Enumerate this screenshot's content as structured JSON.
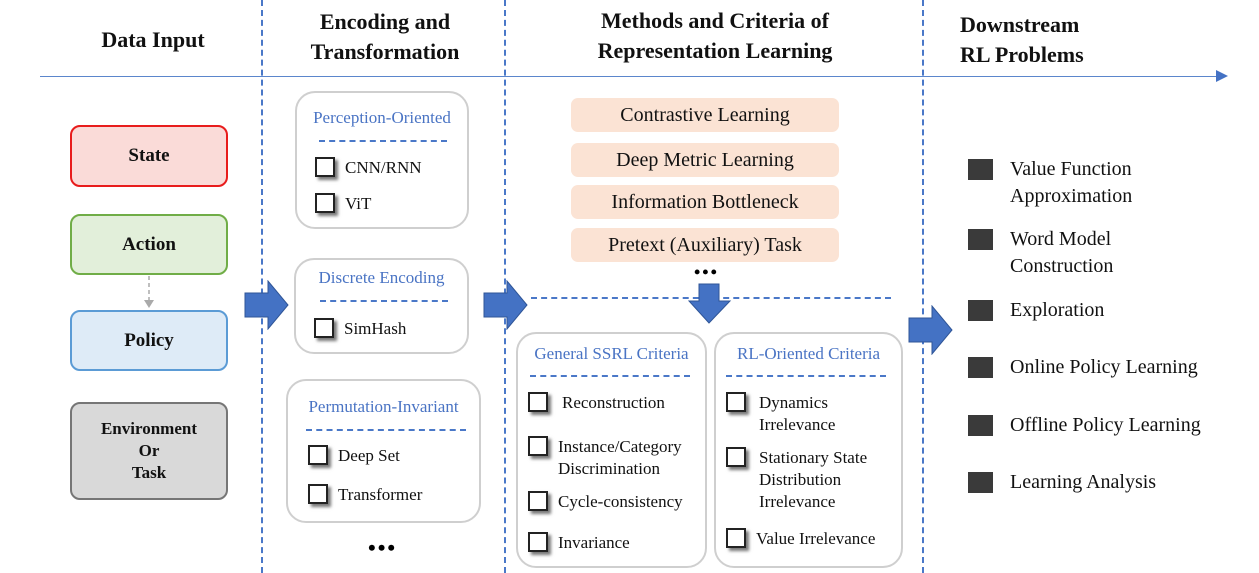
{
  "headers": {
    "data_input": "Data Input",
    "encoding": [
      "Encoding and",
      "Transformation"
    ],
    "methods": [
      "Methods and Criteria of",
      "Representation Learning"
    ],
    "downstream": [
      "Downstream",
      "RL Problems"
    ]
  },
  "data_inputs": [
    {
      "label": "State",
      "fill": "#fadbd8",
      "border": "#e81c1c"
    },
    {
      "label": "Action",
      "fill": "#e2efda",
      "border": "#70ad47"
    },
    {
      "label": "Policy",
      "fill": "#deebf7",
      "border": "#5b9bd5"
    },
    {
      "label_lines": [
        "Environment",
        "Or",
        "Task"
      ],
      "fill": "#d9d9d9",
      "border": "#767676"
    }
  ],
  "encoding_cards": [
    {
      "title": "Perception-Oriented",
      "items": [
        "CNN/RNN",
        "ViT"
      ]
    },
    {
      "title": "Discrete Encoding",
      "items": [
        "SimHash"
      ]
    },
    {
      "title": "Permutation-Invariant",
      "items": [
        "Deep Set",
        "Transformer"
      ]
    }
  ],
  "encoding_more": "•••",
  "methods": [
    "Contrastive Learning",
    "Deep Metric Learning",
    "Information Bottleneck",
    "Pretext (Auxiliary) Task"
  ],
  "methods_more": "•••",
  "criteria_cards": [
    {
      "title": "General SSRL Criteria",
      "items": [
        [
          "Reconstruction"
        ],
        [
          "Instance/Category",
          "Discrimination"
        ],
        [
          "Cycle-consistency"
        ],
        [
          "Invariance"
        ]
      ]
    },
    {
      "title": "RL-Oriented Criteria",
      "items": [
        [
          "Dynamics",
          "Irrelevance"
        ],
        [
          "Stationary State",
          "Distribution",
          "Irrelevance"
        ],
        [
          "Value Irrelevance"
        ]
      ]
    }
  ],
  "problems": [
    [
      "Value Function",
      "Approximation"
    ],
    [
      "Word Model",
      "Construction"
    ],
    [
      "Exploration"
    ],
    [
      "Online Policy Learning"
    ],
    [
      "Offline Policy Learning"
    ],
    [
      "Learning Analysis"
    ]
  ],
  "colors": {
    "accent_blue": "#4472c4",
    "divider": "#4a78c8",
    "method_fill": "#fbe3d4",
    "card_title": "#4a74c4"
  }
}
